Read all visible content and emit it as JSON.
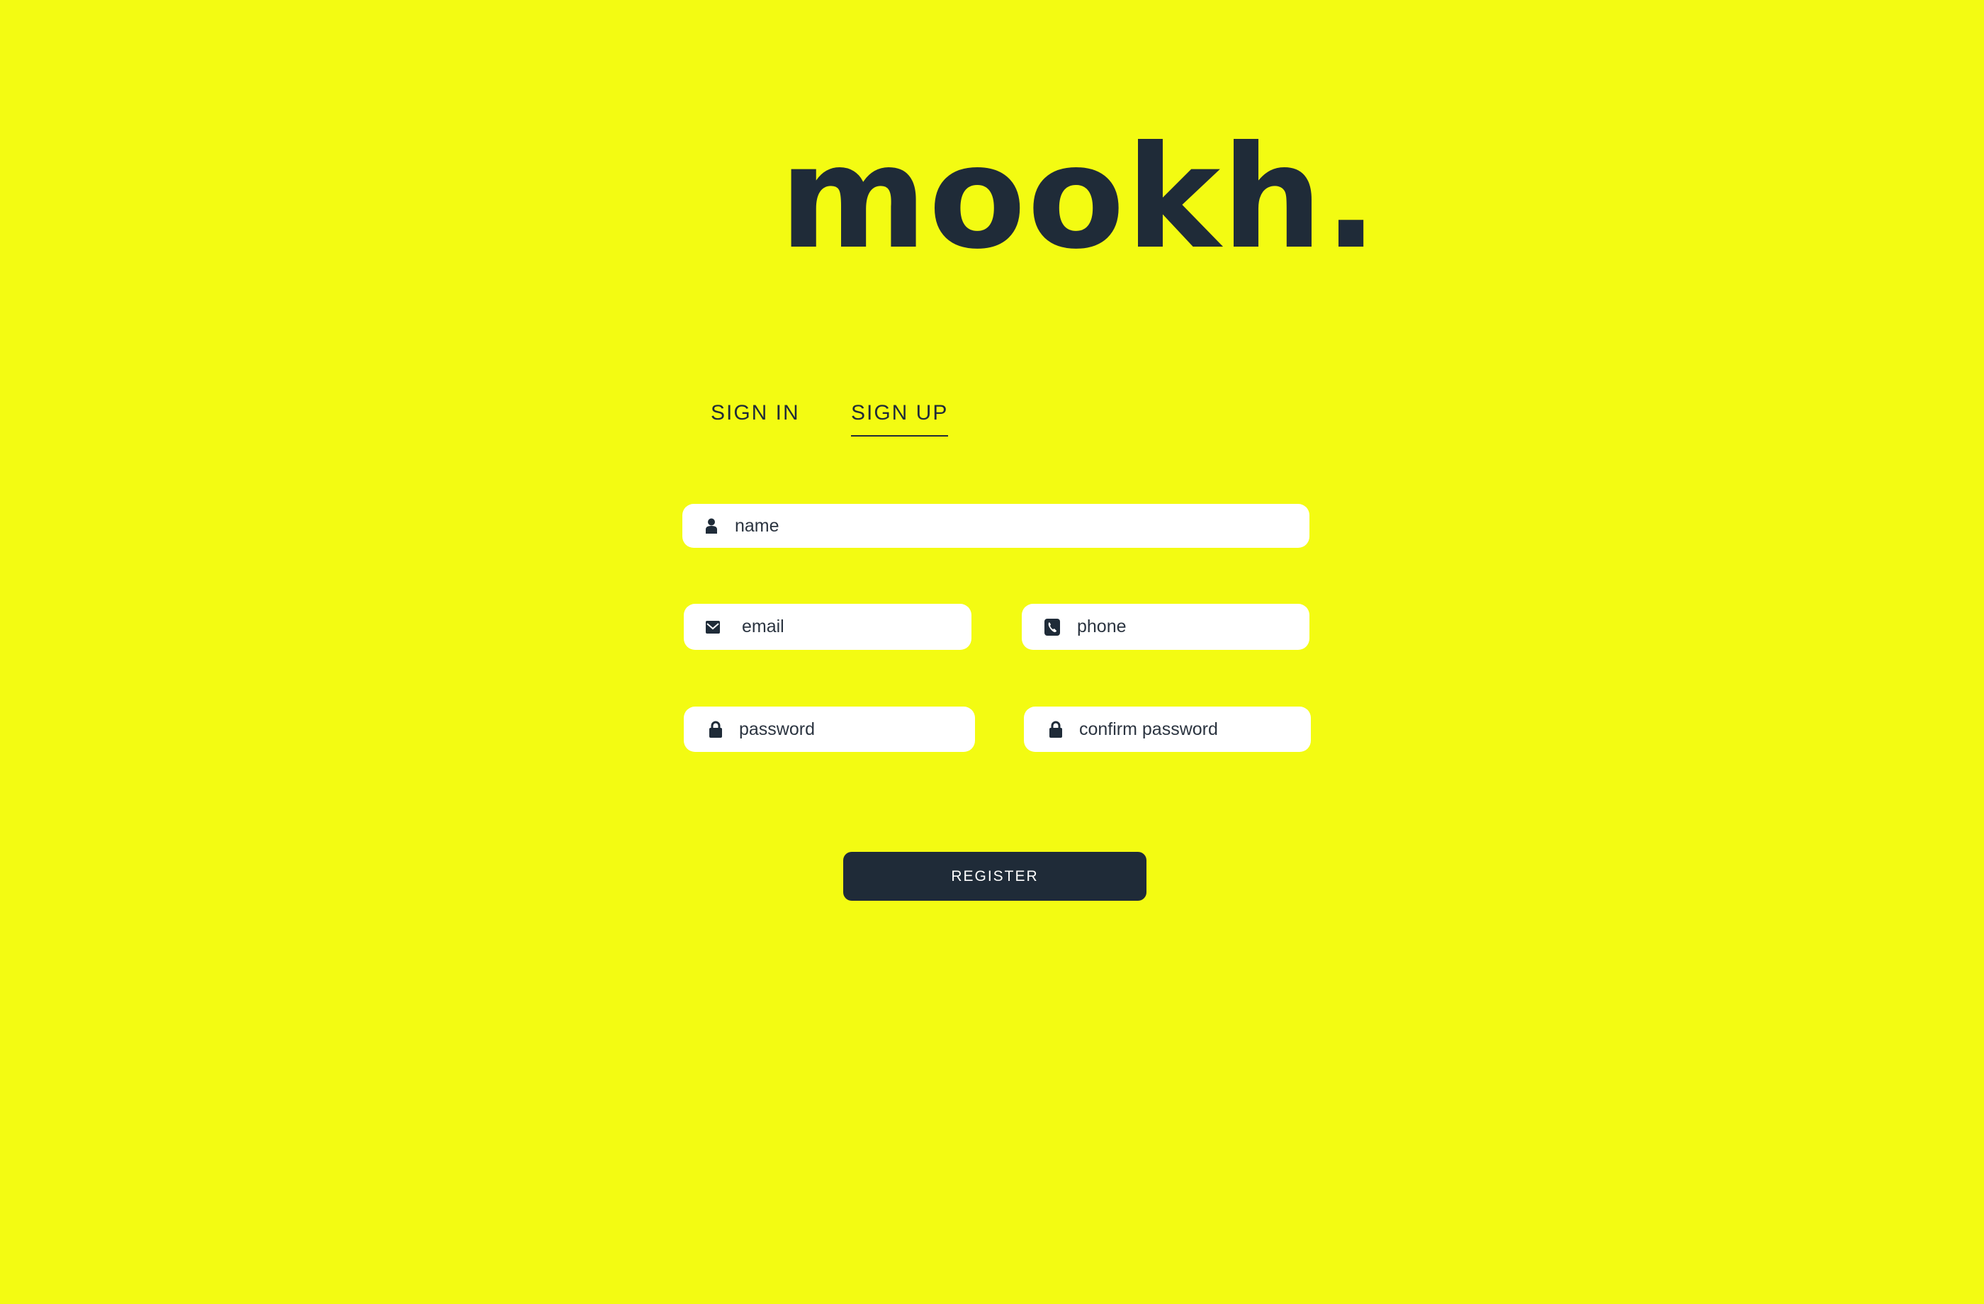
{
  "logo": {
    "text": "mookh."
  },
  "tabs": [
    {
      "label": "SIGN IN",
      "active": false
    },
    {
      "label": "SIGN UP",
      "active": true
    }
  ],
  "form": {
    "name": {
      "placeholder": "name",
      "icon": "user-icon",
      "value": ""
    },
    "email": {
      "placeholder": "email",
      "icon": "envelope-icon",
      "value": ""
    },
    "phone": {
      "placeholder": "phone",
      "icon": "phone-icon",
      "value": ""
    },
    "password": {
      "placeholder": "password",
      "icon": "lock-icon",
      "value": ""
    },
    "confirm_password": {
      "placeholder": "confirm password",
      "icon": "lock-icon",
      "value": ""
    },
    "submit_label": "REGISTER"
  },
  "colors": {
    "background": "#f3fb12",
    "primary": "#1f2b38",
    "input_bg": "#ffffff"
  }
}
